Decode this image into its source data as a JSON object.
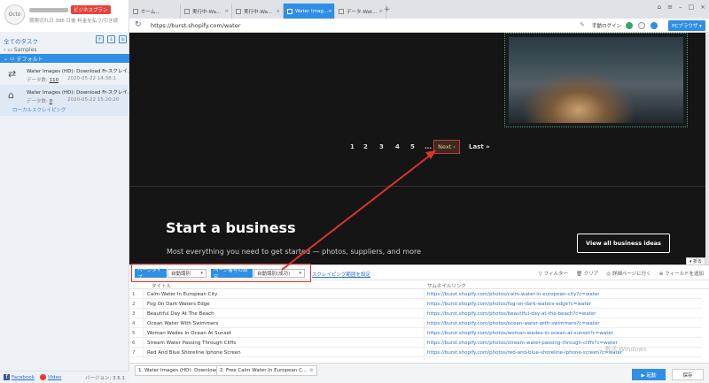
{
  "sidebar": {
    "logo_text": "Octo",
    "plan_badge": "ビジネスプラン",
    "account_info": "期限切れ日 386 日後  料金を払う/引き続",
    "tasks_title": "全てのタスク",
    "groups": {
      "samples": "Samples",
      "default": "デフォルト"
    },
    "tasks": [
      {
        "name": "Water Images (HD): Download Fr-スクレイ...",
        "data_label": "データ数:",
        "count": "110",
        "date": "2020-05-22 14:38:1"
      },
      {
        "name": "Water Images (HD): Download Fr-スクレイ...",
        "data_label": "データ数:",
        "count": "0",
        "date": "2020-05-22 15:20:20",
        "sub": "ローカルスクレイピング"
      }
    ],
    "footer": {
      "facebook": "Facebook",
      "video": "Video",
      "version": "バージョン: 3.5.1"
    }
  },
  "browser": {
    "tabs": [
      {
        "label": "ホーム..."
      },
      {
        "label": "実行中-Wa..."
      },
      {
        "label": "実行中-Wa..."
      },
      {
        "label": "Water Imag..."
      },
      {
        "label": "データ-Wat..."
      }
    ],
    "url": "https://burst.shopify.com/water",
    "login": "手動ログイン",
    "pc_browser": "PCブラウザ ▾"
  },
  "webpage": {
    "pagination": [
      "1",
      "2",
      "3",
      "4",
      "5",
      "..."
    ],
    "next_label": "Next ›",
    "last_label": "Last »",
    "business_title": "Start a business",
    "business_subtitle": "Most everything you need to get started — photos, suppliers, and more",
    "business_button": "View all business ideas"
  },
  "panel": {
    "page_type_label": "ページタイプ",
    "page_type_value": "自動識別",
    "page_setting_label": "ページ番号の設定",
    "page_setting_value": "自動識別(成功)",
    "scrape_link": "スクレイピング範囲を設定",
    "tools": {
      "filter": "フィルター",
      "clear": "クリア",
      "detail": "詳細ページに行く",
      "add_field": "フィールドを追加"
    },
    "collapse_label": "▾ 折る",
    "columns": {
      "title": "タイトル",
      "thumb": "サムネイルリンク"
    },
    "rows": [
      {
        "no": "1",
        "title": "Calm Water In European City",
        "link": "https://burst.shopify.com/photos/calm-water-in-european-city?c=water"
      },
      {
        "no": "2",
        "title": "Fog On Dark Waters Edge",
        "link": "https://burst.shopify.com/photos/fog-on-dark-waters-edge?c=water"
      },
      {
        "no": "3",
        "title": "Beautiful Day At The Beach",
        "link": "https://burst.shopify.com/photos/beautiful-day-at-the-beach?c=water"
      },
      {
        "no": "4",
        "title": "Ocean Water With Swimmers",
        "link": "https://burst.shopify.com/photos/ocean-water-with-swimmers?c=water"
      },
      {
        "no": "5",
        "title": "Woman Wades In Ocean At Sunset",
        "link": "https://burst.shopify.com/photos/woman-wades-in-ocean-at-sunset?c=water"
      },
      {
        "no": "6",
        "title": "Stream Water Passing Through Cliffs",
        "link": "https://burst.shopify.com/photos/stream-water-passing-through-cliffs?c=water"
      },
      {
        "no": "7",
        "title": "Red And Blue Shoreline Iphone Screen",
        "link": "https://burst.shopify.com/photos/red-and-blue-shoreline-iphone-screen?c=water"
      }
    ],
    "bottom_tabs": [
      "1. Water Images (HD): Download F...",
      "2. Free Calm Water In European C..."
    ],
    "start_button": "▶ 起動",
    "save_button": "保存",
    "watermark": "激活 Windows"
  },
  "colors": {
    "accent": "#2f8ee6",
    "highlight_red": "#e0322b",
    "dark_bg": "#151515"
  }
}
